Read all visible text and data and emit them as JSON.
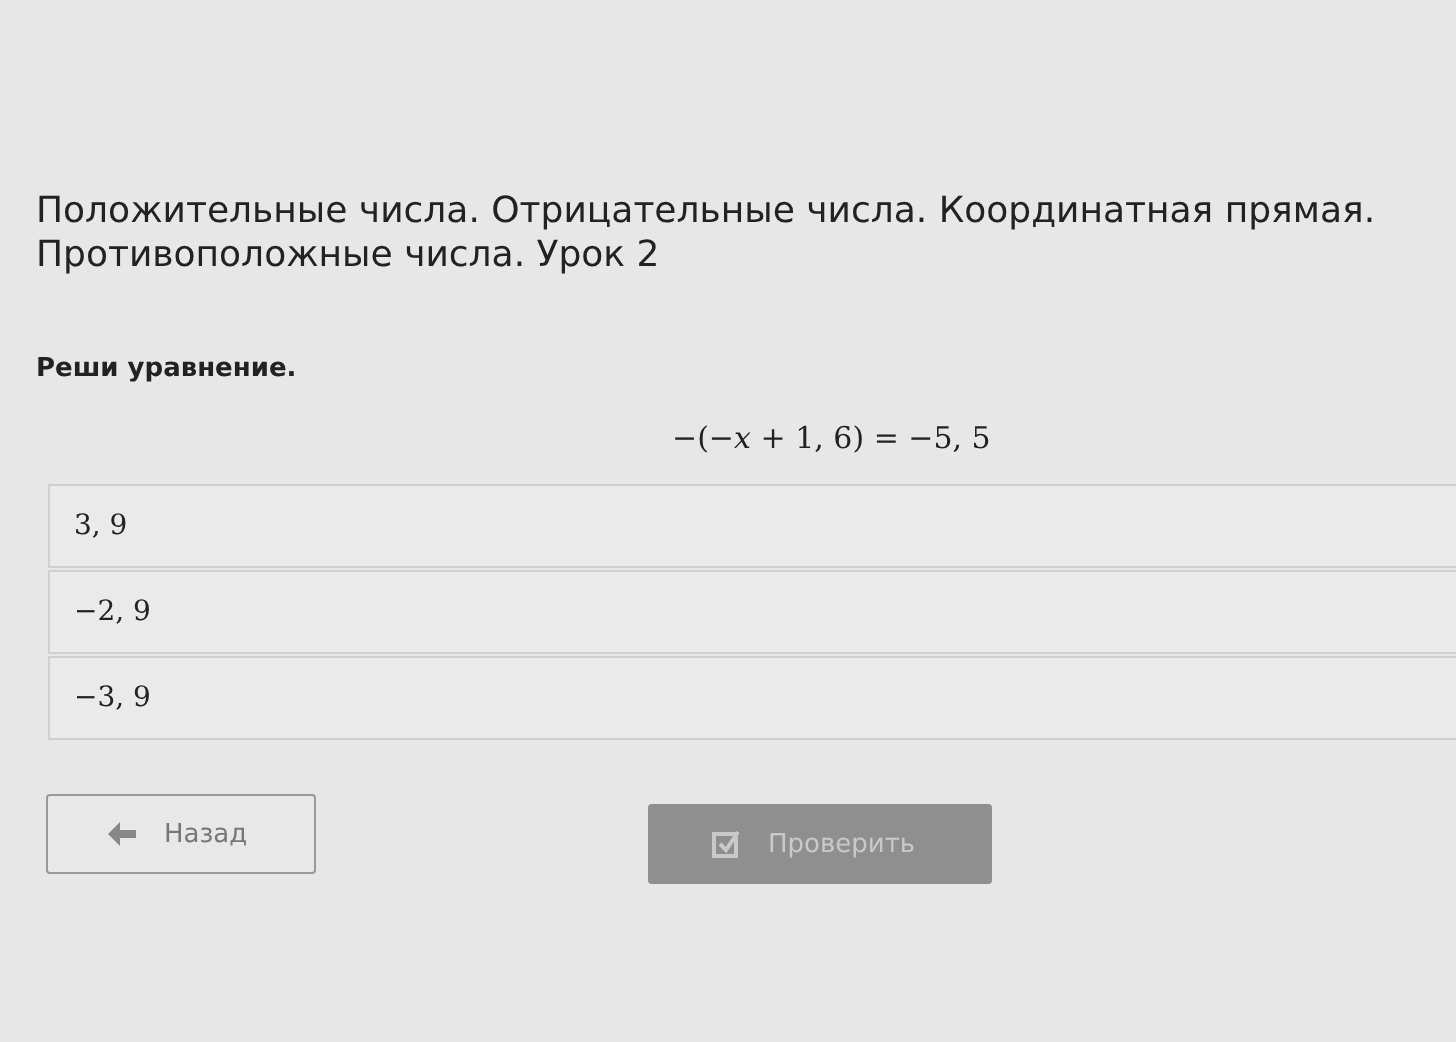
{
  "lesson_title": "Положительные числа. Отрицательные числа. Координатная прямая. Противоположные числа. Урок 2",
  "task": {
    "prompt": "Реши уравнение.",
    "equation": "−(−*x* + 1, 6) = −5, 5"
  },
  "options": [
    {
      "label": "3, 9",
      "selected": false
    },
    {
      "label": "−2, 9",
      "selected": false
    },
    {
      "label": "−3, 9",
      "selected": false
    }
  ],
  "buttons": [
    {
      "kind": "back",
      "label": "Назад",
      "disabled": false
    },
    {
      "kind": "check",
      "label": "Проверить",
      "disabled": true
    }
  ]
}
